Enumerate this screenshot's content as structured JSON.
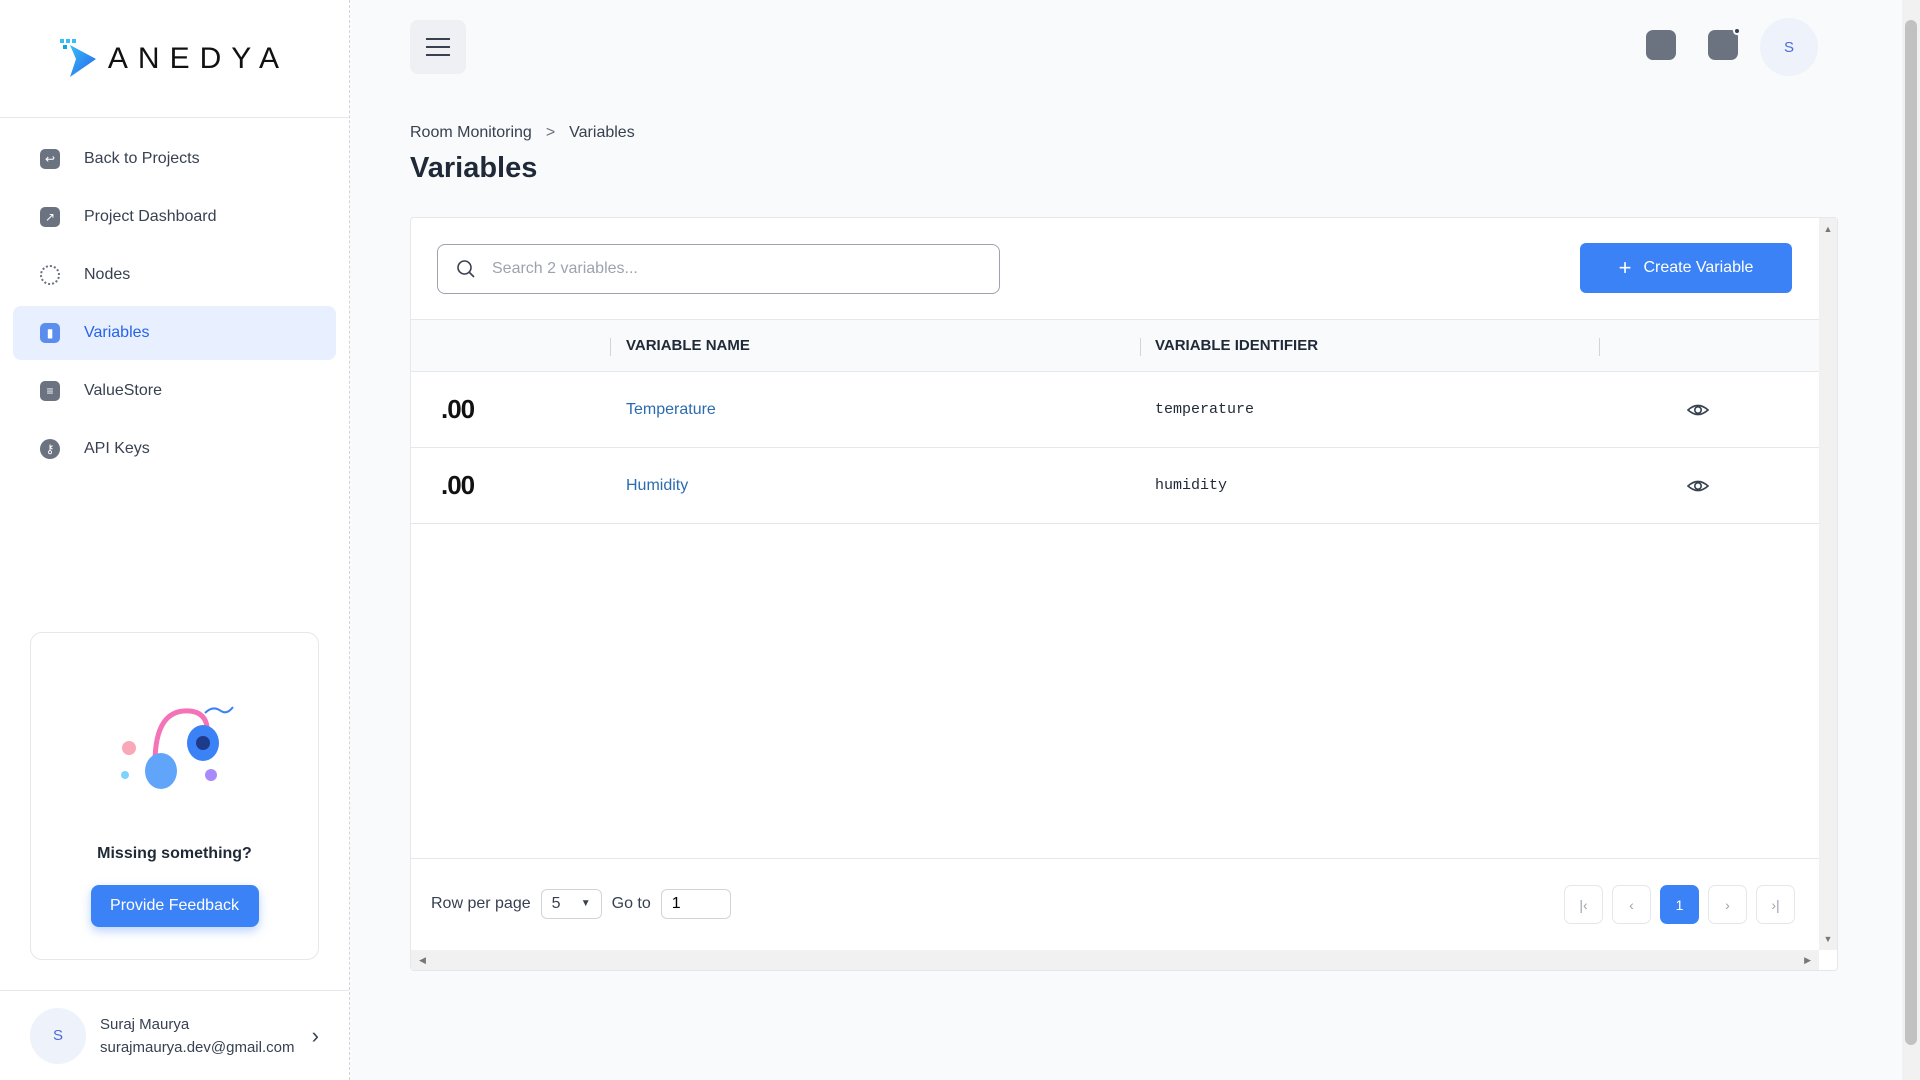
{
  "brand": {
    "name": "ANEDYA",
    "accent": "#3b82f6"
  },
  "sidebar": {
    "items": [
      {
        "label": "Back to Projects",
        "icon": "back-arrow-icon"
      },
      {
        "label": "Project Dashboard",
        "icon": "chart-line-icon"
      },
      {
        "label": "Nodes",
        "icon": "nodes-icon"
      },
      {
        "label": "Variables",
        "icon": "bar-chart-icon",
        "active": true
      },
      {
        "label": "ValueStore",
        "icon": "layers-icon"
      },
      {
        "label": "API Keys",
        "icon": "key-icon"
      }
    ],
    "feedback": {
      "title": "Missing something?",
      "button": "Provide Feedback"
    },
    "user": {
      "initial": "S",
      "name": "Suraj Maurya",
      "email": "surajmaurya.dev@gmail.com"
    }
  },
  "header": {
    "avatar_initial": "S"
  },
  "breadcrumb": {
    "parent": "Room Monitoring",
    "separator": ">",
    "current": "Variables"
  },
  "page_title": "Variables",
  "search": {
    "placeholder": "Search 2 variables..."
  },
  "create_button": {
    "icon": "+",
    "label": "Create Variable"
  },
  "table": {
    "columns": [
      "VARIABLE NAME",
      "VARIABLE IDENTIFIER"
    ],
    "rows": [
      {
        "icon_text": ".00",
        "name": "Temperature",
        "identifier": "temperature"
      },
      {
        "icon_text": ".00",
        "name": "Humidity",
        "identifier": "humidity"
      }
    ]
  },
  "pagination": {
    "rows_per_page_label": "Row per page",
    "rows_per_page": "5",
    "goto_label": "Go to",
    "goto_value": "1",
    "current_page": "1"
  }
}
